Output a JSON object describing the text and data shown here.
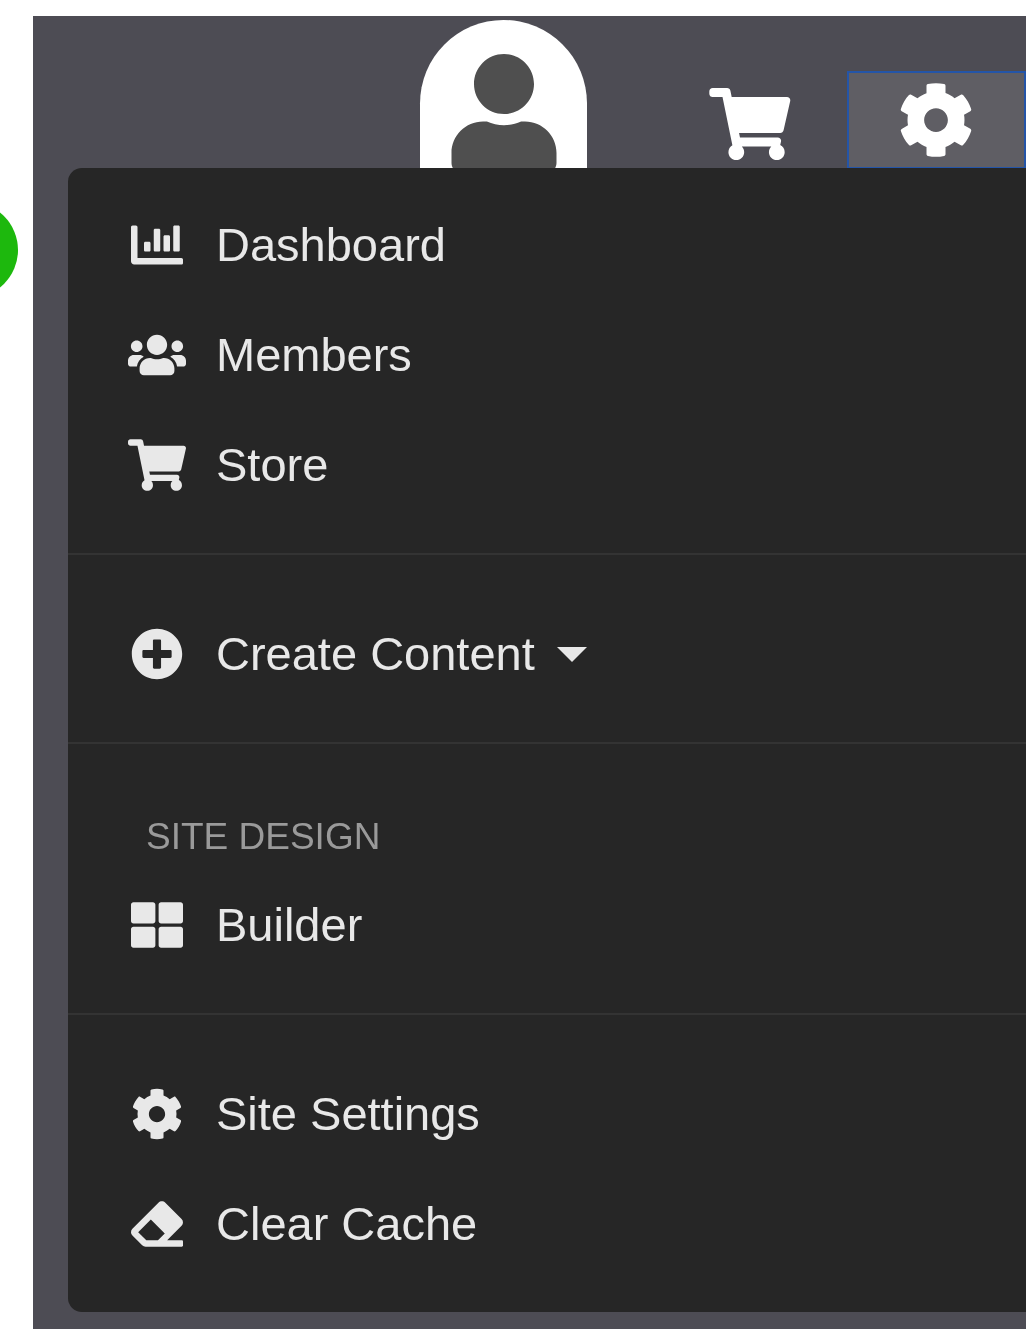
{
  "menu": {
    "sections": [
      {
        "items": [
          {
            "kind": "link",
            "label": "Dashboard"
          },
          {
            "kind": "link",
            "label": "Members"
          },
          {
            "kind": "link",
            "label": "Store"
          }
        ]
      },
      {
        "items": [
          {
            "kind": "dropdown",
            "label": "Create Content"
          }
        ]
      },
      {
        "items": [
          {
            "kind": "header",
            "label": "SITE DESIGN"
          },
          {
            "kind": "link",
            "label": "Builder"
          }
        ]
      },
      {
        "items": [
          {
            "kind": "link",
            "label": "Site Settings"
          },
          {
            "kind": "link",
            "label": "Clear Cache"
          }
        ]
      }
    ]
  }
}
